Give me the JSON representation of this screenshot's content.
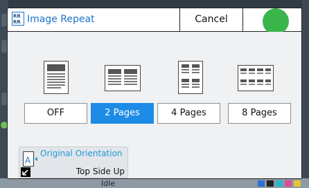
{
  "header": {
    "title": "Image Repeat",
    "cancel_label": "Cancel",
    "mode_icon": "image-repeat-icon"
  },
  "options": [
    {
      "label": "OFF",
      "selected": false
    },
    {
      "label": "2 Pages",
      "selected": true
    },
    {
      "label": "4 Pages",
      "selected": false
    },
    {
      "label": "8 Pages",
      "selected": false
    }
  ],
  "orientation": {
    "title": "Original Orientation",
    "value": "Top Side Up"
  },
  "status": {
    "text": "Idle"
  },
  "colors": {
    "accent": "#1c8be6",
    "title_blue": "#1c72c9",
    "ok_green": "#3ab54a"
  }
}
